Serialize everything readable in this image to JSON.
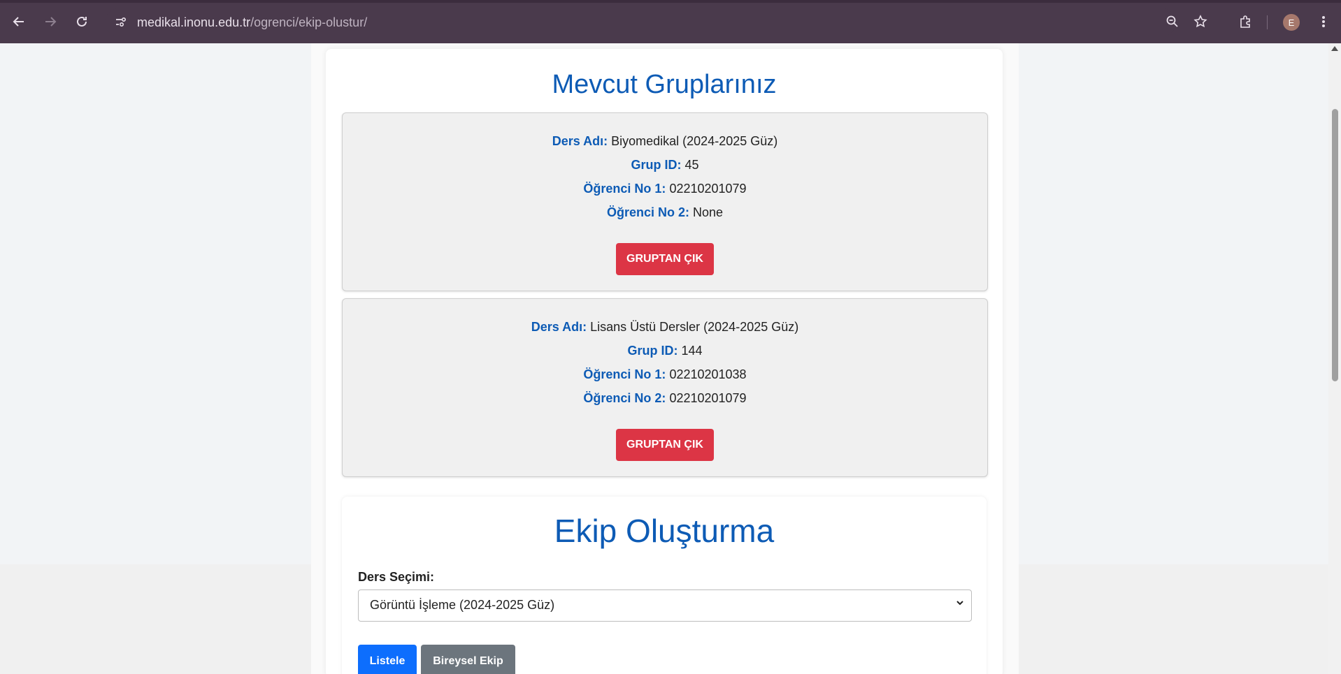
{
  "browser": {
    "url_host": "medikal.inonu.edu.tr",
    "url_path": "/ogrenci/ekip-olustur/",
    "profile_initial": "E"
  },
  "groups_section": {
    "title": "Mevcut Gruplarınız",
    "labels": {
      "course": "Ders Adı:",
      "group_id": "Grup ID:",
      "student1": "Öğrenci No 1:",
      "student2": "Öğrenci No 2:"
    },
    "leave_button": "GRUPTAN ÇIK",
    "groups": [
      {
        "course": "Biyomedikal (2024-2025 Güz)",
        "group_id": "45",
        "student1": "02210201079",
        "student2": "None"
      },
      {
        "course": "Lisans Üstü Dersler (2024-2025 Güz)",
        "group_id": "144",
        "student1": "02210201038",
        "student2": "02210201079"
      }
    ]
  },
  "create_section": {
    "title": "Ekip Oluşturma",
    "course_select_label": "Ders Seçimi:",
    "course_select_value": "Görüntü İşleme (2024-2025 Güz)",
    "list_button": "Listele",
    "individual_button": "Bireysel Ekip"
  },
  "colors": {
    "accent_blue": "#0d5bb5",
    "danger": "#dc3545",
    "primary": "#0d6efd",
    "secondary": "#6c757d",
    "chrome": "#4a3a4c"
  }
}
